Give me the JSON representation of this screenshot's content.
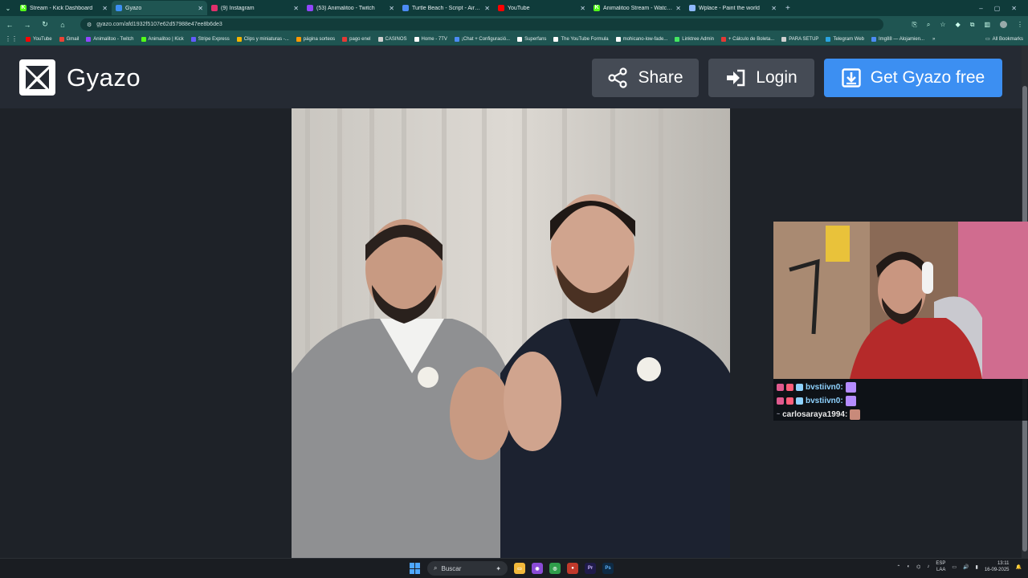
{
  "browser": {
    "tabs": [
      {
        "title": "Stream - Kick Dashboard",
        "favicon_color": "#53fc18",
        "favicon_glyph": "K",
        "active": false
      },
      {
        "title": "Gyazo",
        "favicon_color": "#3c8ff2",
        "favicon_glyph": "",
        "active": true
      },
      {
        "title": "(9) Instagram",
        "favicon_color": "#e1306c",
        "favicon_glyph": "",
        "active": false
      },
      {
        "title": "(53) Animalitoo - Twitch",
        "favicon_color": "#9146ff",
        "favicon_glyph": "",
        "active": false
      },
      {
        "title": "Turtle Beach - Script - Airlite Fit",
        "favicon_color": "#4c8bf5",
        "favicon_glyph": "",
        "active": false
      },
      {
        "title": "YouTube",
        "favicon_color": "#ff0000",
        "favicon_glyph": "",
        "active": false
      },
      {
        "title": "Animalitoo Stream - Watch Live",
        "favicon_color": "#53fc18",
        "favicon_glyph": "K",
        "active": false
      },
      {
        "title": "Wplace - Paint the world",
        "favicon_color": "#8fb9ff",
        "favicon_glyph": "",
        "active": false
      }
    ],
    "url": "gyazo.com/afd1932f5107e62d57988e47ee8b6de3",
    "bookmarks": [
      {
        "label": "YouTube",
        "color": "#ff0000"
      },
      {
        "label": "Gmail",
        "color": "#ea4335"
      },
      {
        "label": "Animalitoo - Twitch",
        "color": "#9146ff"
      },
      {
        "label": "Animalitoo | Kick",
        "color": "#53fc18"
      },
      {
        "label": "Stripe Express",
        "color": "#635bff"
      },
      {
        "label": "Clips y miniaturas -...",
        "color": "#f4b400"
      },
      {
        "label": "página sorteos",
        "color": "#ff9800"
      },
      {
        "label": "pago enel",
        "color": "#e53935"
      },
      {
        "label": "CASINOS",
        "color": "#d0d0d0"
      },
      {
        "label": "Home - 7TV",
        "color": "#ffffff"
      },
      {
        "label": "¡Chat + Configuració...",
        "color": "#4c8bf5"
      },
      {
        "label": "Superfans",
        "color": "#ffffff"
      },
      {
        "label": "The YouTube Formula",
        "color": "#ffffff"
      },
      {
        "label": "mohicano-low-fade...",
        "color": "#ffffff"
      },
      {
        "label": "Linktree Admin",
        "color": "#43e660"
      },
      {
        "label": "+ Cálculo de Boleta...",
        "color": "#e53935"
      },
      {
        "label": "PARA SETUP",
        "color": "#d0d0d0"
      },
      {
        "label": "Telegram Web",
        "color": "#2aa3e1"
      },
      {
        "label": "Img88 — Alojamien...",
        "color": "#4c8bf5"
      }
    ],
    "all_bookmarks_label": "All Bookmarks"
  },
  "gyazo": {
    "logo_text": "Gyazo",
    "share_label": "Share",
    "login_label": "Login",
    "get_label": "Get Gyazo free",
    "accent": "#3c8ff2"
  },
  "chat": [
    {
      "user": "bvstiivn0:",
      "user_color": "#8fd3ff"
    },
    {
      "user": "bvstiivn0:",
      "user_color": "#8fd3ff"
    },
    {
      "user": "carlosaraya1994:",
      "user_color": "#e9e9e9"
    }
  ],
  "taskbar": {
    "search_placeholder": "Buscar",
    "lang_top": "ESP",
    "lang_bottom": "LAA",
    "time": "13:11",
    "date": "16-09-2025"
  }
}
